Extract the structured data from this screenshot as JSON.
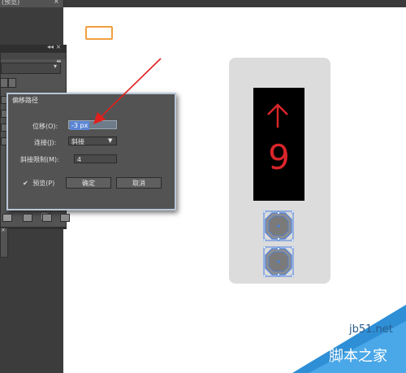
{
  "tab": {
    "label": "(预览)",
    "close": "×"
  },
  "panel": {
    "header_arrows": "◂◂ ×",
    "menu_icon": "≡",
    "dropdown_arrow": "▾",
    "close": "×"
  },
  "dialog": {
    "title": "偏移路径",
    "offset_label": "位移(O):",
    "offset_value": "-3 px",
    "joins_label": "连接(J):",
    "joins_value": "斜接",
    "miter_label": "斜接限制(M):",
    "miter_value": "4",
    "preview_label": "预览(P)",
    "preview_checked": true,
    "ok_label": "确定",
    "cancel_label": "取消"
  },
  "artwork": {
    "floor_number": "9",
    "direction": "up",
    "display_color": "#d9252a",
    "panel_color": "#dcdcdc"
  },
  "watermark": {
    "url": "jb51.net",
    "site": "脚本之家"
  },
  "colors": {
    "annotation_arrow": "#e0201c",
    "selection": "#4a7fe0"
  }
}
